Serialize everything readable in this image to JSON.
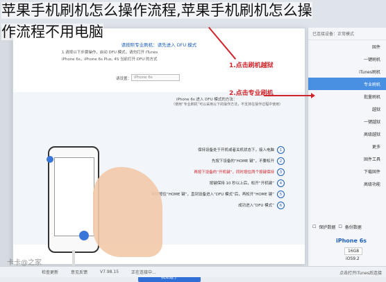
{
  "overlay": {
    "line1": "苹果手机刷机怎么操作流程,苹果手机刷机怎么操",
    "line2": "作流程不用电脑"
  },
  "dialog": {
    "title": "请按照专业刷机：请先进入 DFU 模式",
    "line1": "1.请按以下步骤操作，启动 DFU 模式，请勿打开 ITunes",
    "line2": "iPhone 6s，iPhone 6s Plus, 4S 当前打开 DFU 的方式",
    "select_label": "请设置：",
    "select_value": "iPhone 6s",
    "steps_title": "iPhone 6s 进入 DFU 模式的方法：",
    "steps_sub": "（使用“专业刷机”可以采用以下的操作方法，不支持在操作过程中使用）",
    "steps": [
      {
        "num": "1",
        "text": "保持设备处于开机或者关机状态下，接入电脑",
        "red": false
      },
      {
        "num": "2",
        "text": "先按下设备的“HOME 键”，不要松开",
        "red": false
      },
      {
        "num": "3",
        "text": "再按下设备的“开机键”，同时按住两个按键保持",
        "red": true
      },
      {
        "num": "4",
        "text": "按键保持 10 秒以上后，松开“开机键”",
        "red": false
      },
      {
        "num": "5",
        "text": "继续按住“HOME 键”，直到设备进入“DFU 模式”后，再松开“HOME 键”",
        "red": false
      },
      {
        "num": "6",
        "text": "成功进入“DFU 模式”",
        "red": false
      }
    ],
    "confirm_label": "我知道了"
  },
  "annotations": {
    "a1": "1.点击刷机越狱",
    "a2": "2.点击专业刷机"
  },
  "sidebar": {
    "top": "已连接设备：正常模式",
    "items": [
      {
        "label": "固件",
        "active": false
      },
      {
        "label": "一键刷机",
        "active": false
      },
      {
        "label": "iTunes刷机",
        "active": false
      },
      {
        "label": "专业刷机",
        "active": true
      },
      {
        "label": "批量刷机",
        "active": false
      },
      {
        "label": "越狱",
        "active": false
      },
      {
        "label": "一键越狱",
        "active": false
      },
      {
        "label": "高级越狱",
        "active": false
      },
      {
        "label": "更多",
        "active": false
      },
      {
        "label": "固件工具",
        "active": false
      },
      {
        "label": "下载固件",
        "active": false
      },
      {
        "label": "高级功能",
        "active": false
      }
    ],
    "check_label": "保护数据",
    "check2_label": "备份数据",
    "device_name": "iPhone 6s",
    "device_code": "16G8",
    "device_state": "iOS9.2"
  },
  "statusbar": {
    "items": [
      "检查更新",
      "意见反馈",
      "V7.98.15",
      "正在连接中..."
    ],
    "right": "点击打开iTunes后连接"
  },
  "watermark": "卡卡@之家"
}
